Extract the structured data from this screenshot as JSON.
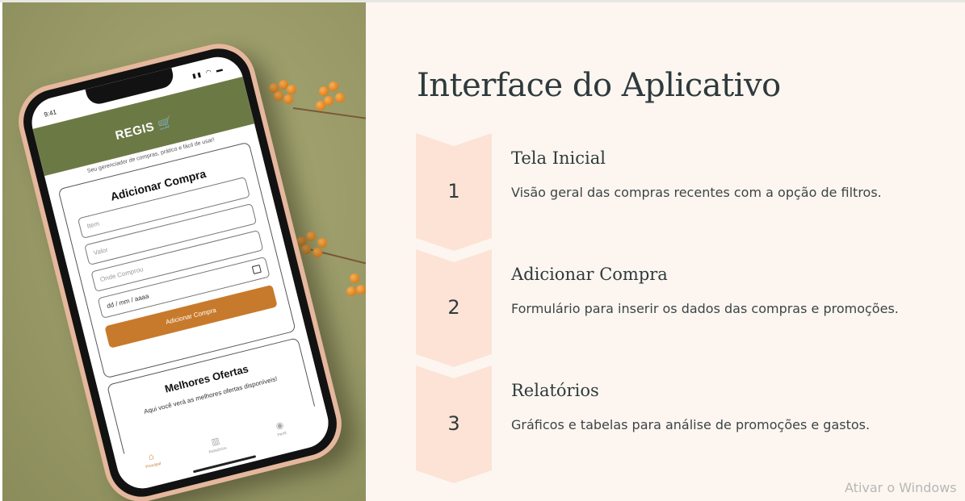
{
  "slide": {
    "title": "Interface do Aplicativo",
    "steps": [
      {
        "number": "1",
        "title": "Tela Inicial",
        "description": "Visão geral das compras recentes com a opção de filtros."
      },
      {
        "number": "2",
        "title": "Adicionar Compra",
        "description": "Formulário para inserir os dados das compras e promoções."
      },
      {
        "number": "3",
        "title": "Relatórios",
        "description": "Gráficos e tabelas para análise de promoções e gastos."
      }
    ],
    "chevron_color": "#fce3d5",
    "background": "#fdf6f0",
    "text_color": "#2e3a3d"
  },
  "phone_app": {
    "status_time": "9:41",
    "status_icons": "signal-wifi-battery",
    "logo": "REGIS",
    "logo_icon": "shopping-cart-icon",
    "tagline": "Seu gerenciador de compras, prático e fácil de usar!",
    "form": {
      "title": "Adicionar Compra",
      "item_placeholder": "Item",
      "value_placeholder": "Valor",
      "store_placeholder": "Onde Comprou",
      "date_placeholder": "dd / mm / aaaa",
      "submit_label": "Adicionar Compra"
    },
    "offers": {
      "title": "Melhores Ofertas",
      "text": "Aqui você verá as melhores ofertas disponíveis!"
    },
    "nav": [
      {
        "label": "Principal",
        "icon": "home-icon"
      },
      {
        "label": "Relatórios",
        "icon": "reports-icon"
      },
      {
        "label": "Perfil",
        "icon": "profile-icon"
      }
    ],
    "header_color": "#6b7a45",
    "button_color": "#c77a2c"
  },
  "watermark": "Ativar o Windows"
}
